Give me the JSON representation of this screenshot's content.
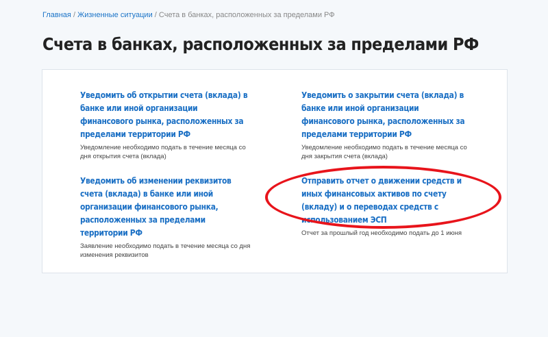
{
  "breadcrumb": {
    "home": "Главная",
    "life": "Жизненные ситуации",
    "current": "Счета в банках, расположенных за пределами РФ",
    "separator": "/"
  },
  "page": {
    "title": "Счета в банках, расположенных за пределами РФ"
  },
  "items": [
    {
      "title": "Уведомить об открытии счета (вклада) в банке или иной организации финансового рынка, расположенных за пределами территории РФ",
      "desc": "Уведомление необходимо подать в течение месяца со дня открытия счета (вклада)"
    },
    {
      "title": "Уведомить о закрытии счета (вклада) в банке или иной организации финансового рынка, расположенных за пределами территории РФ",
      "desc": "Уведомление необходимо подать в течение месяца со дня закрытия счета (вклада)"
    },
    {
      "title": "Уведомить об изменении реквизитов счета (вклада) в банке или иной организации финансового рынка, расположенных за пределами территории РФ",
      "desc": "Заявление необходимо подать в течение месяца со дня изменения реквизитов"
    },
    {
      "title": "Отправить отчет о движении средств и иных финансовых активов по счету (вкладу) и о переводах средств с использованием ЭСП",
      "desc": "Отчет за прошлый год необходимо подать до 1 июня"
    }
  ],
  "colors": {
    "link": "#1a6fc4",
    "highlight": "#e8141b",
    "background": "#f5f8fb"
  }
}
